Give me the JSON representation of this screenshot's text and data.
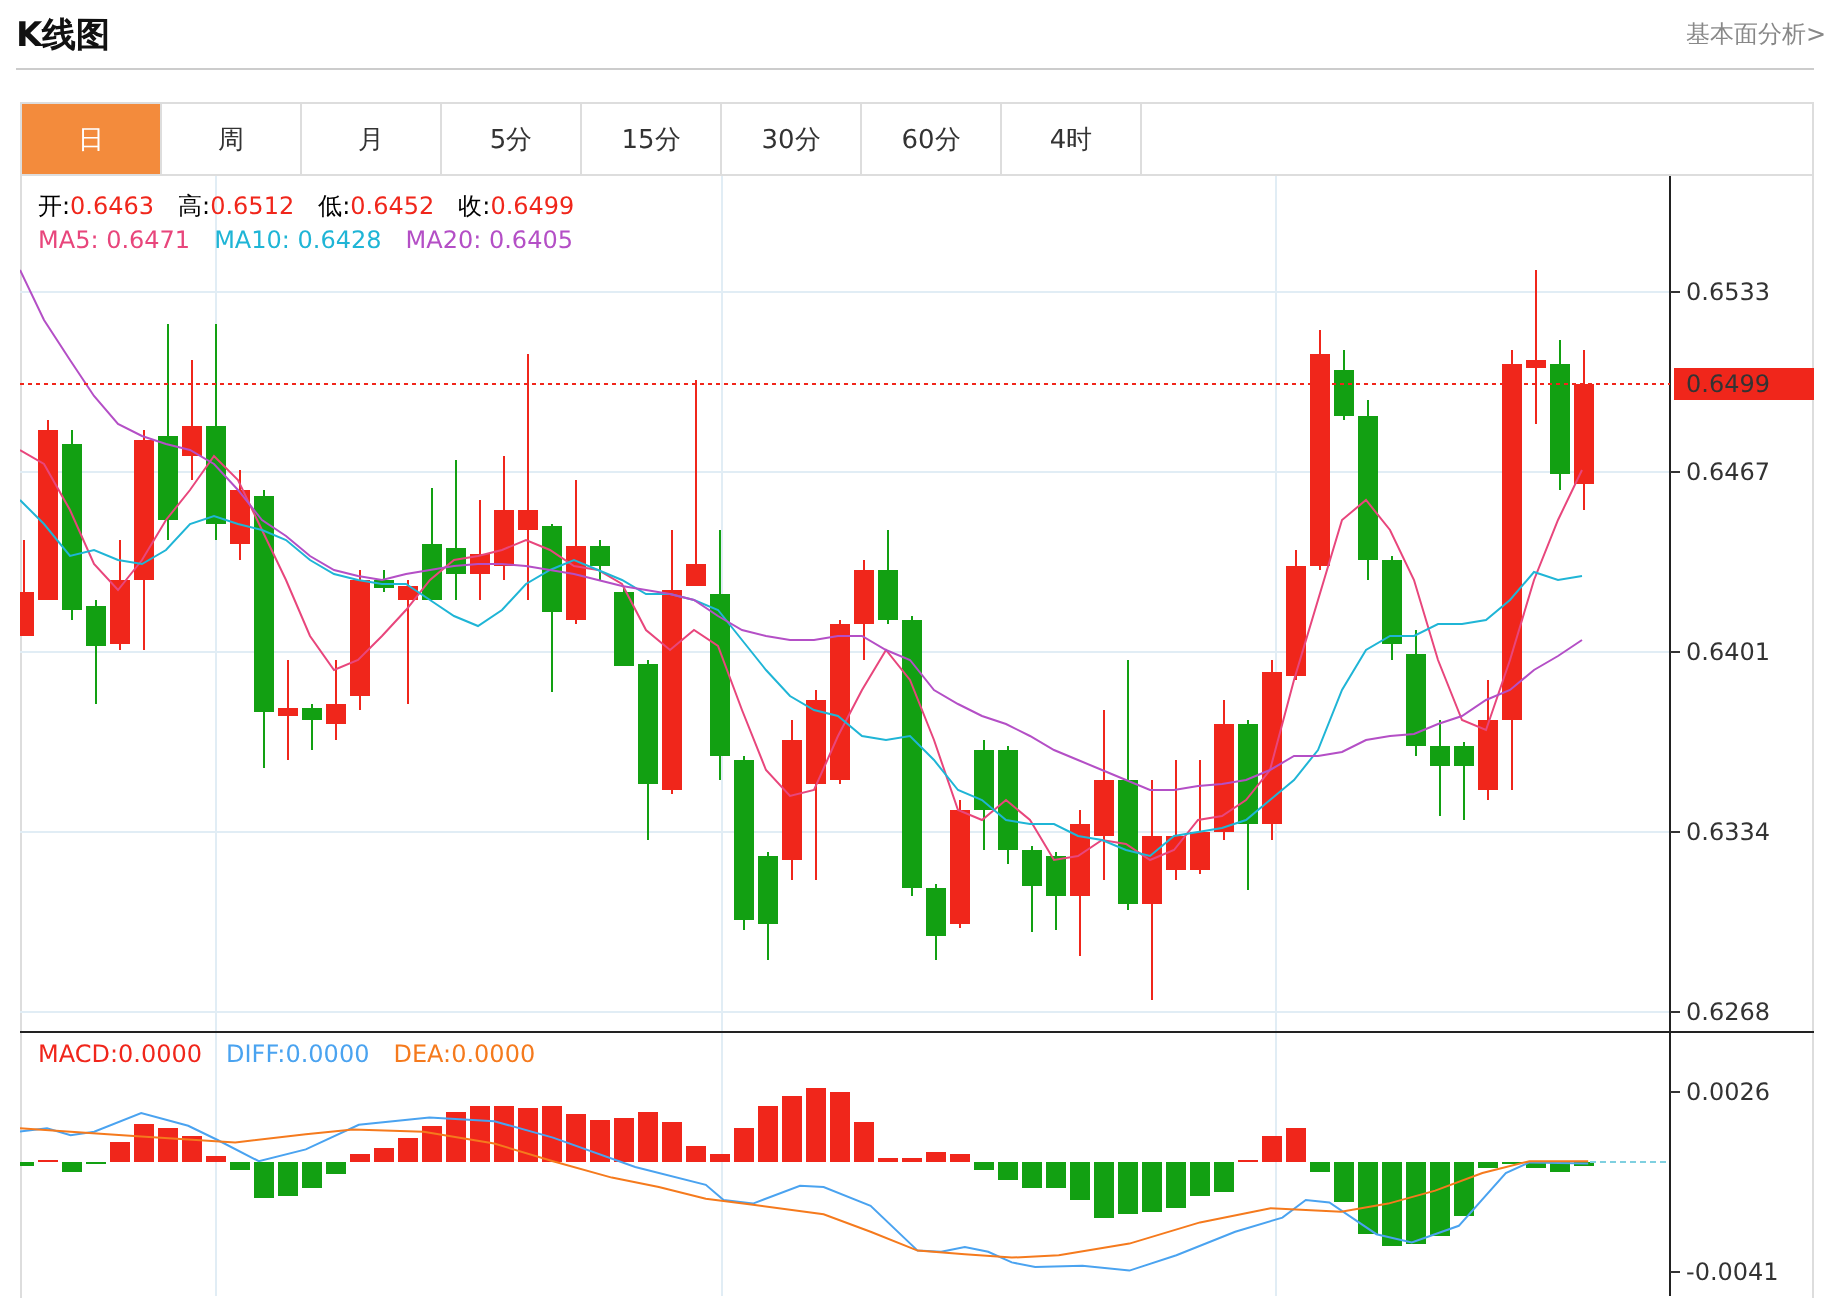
{
  "header": {
    "title": "K线图",
    "link": "基本面分析>"
  },
  "tabs": [
    {
      "label": "日",
      "selected": true
    },
    {
      "label": "周",
      "selected": false
    },
    {
      "label": "月",
      "selected": false
    },
    {
      "label": "5分",
      "selected": false
    },
    {
      "label": "15分",
      "selected": false
    },
    {
      "label": "30分",
      "selected": false
    },
    {
      "label": "60分",
      "selected": false
    },
    {
      "label": "4时",
      "selected": false
    }
  ],
  "quote": [
    {
      "label": "开:",
      "value": "0.6463"
    },
    {
      "label": "高:",
      "value": "0.6512"
    },
    {
      "label": "低:",
      "value": "0.6452"
    },
    {
      "label": "收:",
      "value": "0.6499"
    }
  ],
  "moving_averages": [
    {
      "label": "MA5:",
      "value": "0.6471",
      "color": "#e8467c"
    },
    {
      "label": "MA10:",
      "value": "0.6428",
      "color": "#1fb5d6"
    },
    {
      "label": "MA20:",
      "value": "0.6405",
      "color": "#b44fc6"
    }
  ],
  "price_axis": [
    "0.6533",
    "0.6467",
    "0.6401",
    "0.6334",
    "0.6268"
  ],
  "last_price": "0.6499",
  "macd_legend": [
    {
      "label": "MACD:",
      "value": "0.0000",
      "color": "#f0261b"
    },
    {
      "label": "DIFF:",
      "value": "0.0000",
      "color": "#4aa3f0"
    },
    {
      "label": "DEA:",
      "value": "0.0000",
      "color": "#f57a1d"
    }
  ],
  "macd_axis": [
    "0.0026",
    "-0.0041"
  ]
}
